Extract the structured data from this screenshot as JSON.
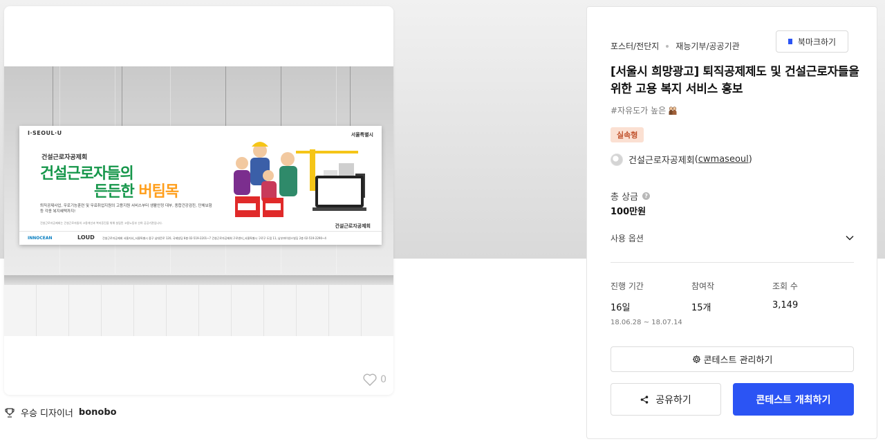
{
  "poster": {
    "logo_left": "I·SEOUL·U",
    "logo_right": "서울특별시",
    "org": "건설근로자공제회",
    "headline_line1": "건설근로자들의",
    "headline_line2_a": "든든한 ",
    "headline_line2_b": "버팀목",
    "description": "퇴직공제사업, 우로기능훈련 및 무료취업지원의 고용지원 서비스부터 생활안정 대부, 종합건강검진, 단체보험 등 각종 복지혜택까지!",
    "note": "건설근로자공제회는 건설근로자들의 고용개선과 복지증진을 위해 설립된 고용노동부 산하 공공기관입니다.",
    "right_org": "건설근로자공제회",
    "footer_innocean": "INNOCEAN",
    "footer_loud": "LOUD",
    "footer_address": "건설근로자공제회 서울지사_서울특별시 중구 남대문로 120, 국제빌딩 8층  02-519-2201~7   건설근로자공제회 구로센터_서울특별시 구로구 도림 11, 남부파이낸스빌딩 2층  02-519-2290~4"
  },
  "likes": {
    "count": "0"
  },
  "award": {
    "label": "우승 디자이너",
    "designer": "bonobo"
  },
  "panel": {
    "category": "포스터/전단지",
    "subcategory": "재능기부/공공기관",
    "bookmark_label": "북마크하기",
    "title": "[서울시 희망광고] 퇴직공제제도 및 건설근로자들을 위한 고용 복지 서비스 홍보",
    "tagline": "#자유도가 높은",
    "badge": "실속형",
    "host_name": "건설근로자공제회",
    "host_handle": "cwmaseoul",
    "prize_label": "총 상금",
    "prize_value": "100만원",
    "usage_label": "사용 옵션",
    "stats": {
      "period_label": "진행 기간",
      "period_value": "16일",
      "period_range": "18.06.28 ~ 18.07.14",
      "participants_label": "참여작",
      "participants_value": "15개",
      "views_label": "조회 수",
      "views_value": "3,149"
    },
    "manage_label": "콘테스트 관리하기",
    "share_label": "공유하기",
    "host_contest_label": "콘테스트 개최하기"
  },
  "colors": {
    "primary": "#2b54f4",
    "badge_bg": "#fbe0d2",
    "badge_text": "#c0502a",
    "poster_green": "#15964a",
    "poster_orange": "#ff9e1b"
  }
}
